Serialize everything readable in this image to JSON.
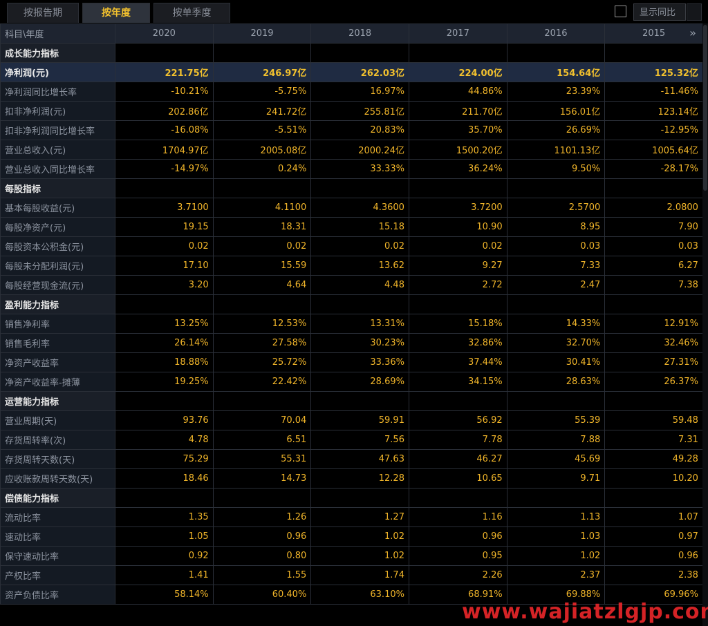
{
  "tabs": [
    {
      "label": "按报告期",
      "active": false
    },
    {
      "label": "按年度",
      "active": true
    },
    {
      "label": "按单季度",
      "active": false
    }
  ],
  "show_yoy": {
    "label": "显示同比",
    "checked": false
  },
  "header": {
    "first_col": "科目\\年度",
    "years": [
      "2020",
      "2019",
      "2018",
      "2017",
      "2016",
      "2015"
    ],
    "next_icon": "double-chevron-right-icon"
  },
  "rows": [
    {
      "type": "section",
      "label": "成长能力指标"
    },
    {
      "type": "highlight",
      "label": "净利润(元)",
      "values": [
        "221.75亿",
        "246.97亿",
        "262.03亿",
        "224.00亿",
        "154.64亿",
        "125.32亿"
      ]
    },
    {
      "type": "data",
      "label": "净利润同比增长率",
      "values": [
        "-10.21%",
        "-5.75%",
        "16.97%",
        "44.86%",
        "23.39%",
        "-11.46%"
      ]
    },
    {
      "type": "data",
      "label": "扣非净利润(元)",
      "values": [
        "202.86亿",
        "241.72亿",
        "255.81亿",
        "211.70亿",
        "156.01亿",
        "123.14亿"
      ]
    },
    {
      "type": "data",
      "label": "扣非净利润同比增长率",
      "values": [
        "-16.08%",
        "-5.51%",
        "20.83%",
        "35.70%",
        "26.69%",
        "-12.95%"
      ]
    },
    {
      "type": "data",
      "label": "营业总收入(元)",
      "values": [
        "1704.97亿",
        "2005.08亿",
        "2000.24亿",
        "1500.20亿",
        "1101.13亿",
        "1005.64亿"
      ]
    },
    {
      "type": "data",
      "label": "营业总收入同比增长率",
      "values": [
        "-14.97%",
        "0.24%",
        "33.33%",
        "36.24%",
        "9.50%",
        "-28.17%"
      ]
    },
    {
      "type": "section",
      "label": "每股指标"
    },
    {
      "type": "data",
      "label": "基本每股收益(元)",
      "values": [
        "3.7100",
        "4.1100",
        "4.3600",
        "3.7200",
        "2.5700",
        "2.0800"
      ]
    },
    {
      "type": "data",
      "label": "每股净资产(元)",
      "values": [
        "19.15",
        "18.31",
        "15.18",
        "10.90",
        "8.95",
        "7.90"
      ]
    },
    {
      "type": "data",
      "label": "每股资本公积金(元)",
      "values": [
        "0.02",
        "0.02",
        "0.02",
        "0.02",
        "0.03",
        "0.03"
      ]
    },
    {
      "type": "data",
      "label": "每股未分配利润(元)",
      "values": [
        "17.10",
        "15.59",
        "13.62",
        "9.27",
        "7.33",
        "6.27"
      ]
    },
    {
      "type": "data",
      "label": "每股经营现金流(元)",
      "values": [
        "3.20",
        "4.64",
        "4.48",
        "2.72",
        "2.47",
        "7.38"
      ]
    },
    {
      "type": "section",
      "label": "盈利能力指标"
    },
    {
      "type": "data",
      "label": "销售净利率",
      "values": [
        "13.25%",
        "12.53%",
        "13.31%",
        "15.18%",
        "14.33%",
        "12.91%"
      ]
    },
    {
      "type": "data",
      "label": "销售毛利率",
      "values": [
        "26.14%",
        "27.58%",
        "30.23%",
        "32.86%",
        "32.70%",
        "32.46%"
      ]
    },
    {
      "type": "data",
      "label": "净资产收益率",
      "values": [
        "18.88%",
        "25.72%",
        "33.36%",
        "37.44%",
        "30.41%",
        "27.31%"
      ]
    },
    {
      "type": "data",
      "label": "净资产收益率-摊薄",
      "values": [
        "19.25%",
        "22.42%",
        "28.69%",
        "34.15%",
        "28.63%",
        "26.37%"
      ]
    },
    {
      "type": "section",
      "label": "运营能力指标"
    },
    {
      "type": "data",
      "label": "营业周期(天)",
      "values": [
        "93.76",
        "70.04",
        "59.91",
        "56.92",
        "55.39",
        "59.48"
      ]
    },
    {
      "type": "data",
      "label": "存货周转率(次)",
      "values": [
        "4.78",
        "6.51",
        "7.56",
        "7.78",
        "7.88",
        "7.31"
      ]
    },
    {
      "type": "data",
      "label": "存货周转天数(天)",
      "values": [
        "75.29",
        "55.31",
        "47.63",
        "46.27",
        "45.69",
        "49.28"
      ]
    },
    {
      "type": "data",
      "label": "应收账款周转天数(天)",
      "values": [
        "18.46",
        "14.73",
        "12.28",
        "10.65",
        "9.71",
        "10.20"
      ]
    },
    {
      "type": "section",
      "label": "偿债能力指标"
    },
    {
      "type": "data",
      "label": "流动比率",
      "values": [
        "1.35",
        "1.26",
        "1.27",
        "1.16",
        "1.13",
        "1.07"
      ]
    },
    {
      "type": "data",
      "label": "速动比率",
      "values": [
        "1.05",
        "0.96",
        "1.02",
        "0.96",
        "1.03",
        "0.97"
      ]
    },
    {
      "type": "data",
      "label": "保守速动比率",
      "values": [
        "0.92",
        "0.80",
        "1.02",
        "0.95",
        "1.02",
        "0.96"
      ]
    },
    {
      "type": "data",
      "label": "产权比率",
      "values": [
        "1.41",
        "1.55",
        "1.74",
        "2.26",
        "2.37",
        "2.38"
      ]
    },
    {
      "type": "data",
      "label": "资产负债比率",
      "values": [
        "58.14%",
        "60.40%",
        "63.10%",
        "68.91%",
        "69.88%",
        "69.96%"
      ]
    }
  ],
  "watermark": "www.wajiatzlgjp.com",
  "colors": {
    "value": "#f2b62a",
    "active_tab": "#f2c12e",
    "highlight_row": "#1f2b42",
    "watermark": "#e8262a"
  }
}
